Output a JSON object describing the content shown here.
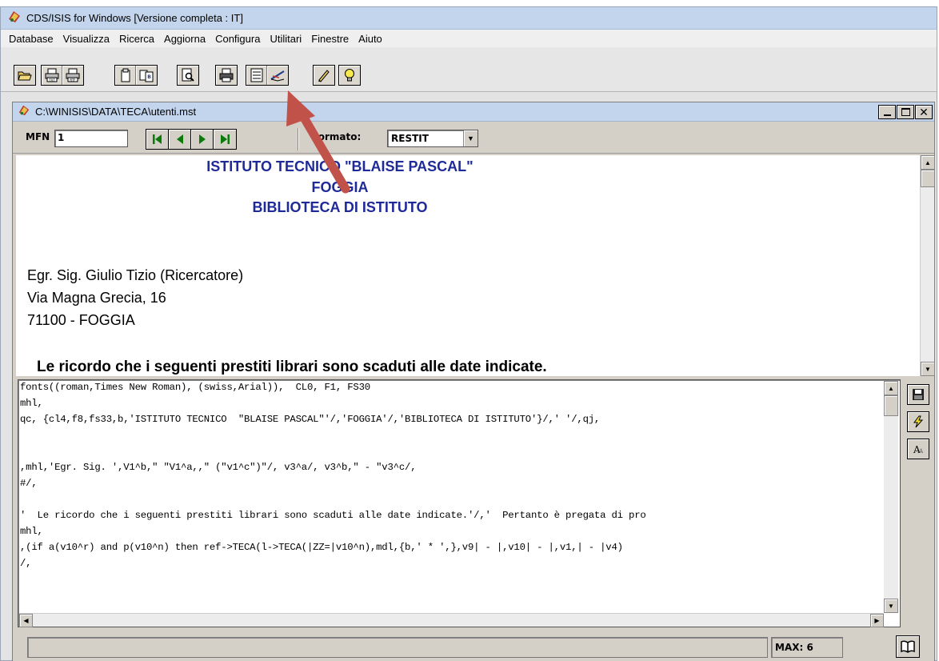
{
  "app": {
    "title": "CDS/ISIS for Windows [Versione completa : IT]",
    "menu": [
      "Database",
      "Visualizza",
      "Ricerca",
      "Aggiorna",
      "Configura",
      "Utilitari",
      "Finestre",
      "Aiuto"
    ],
    "toolbar_icons": [
      "open-folder",
      "print-txt",
      "print-rtf",
      "clipboard",
      "copy-record",
      "preview",
      "print",
      "display-format",
      "edit-format",
      "pencil",
      "lightbulb"
    ]
  },
  "child": {
    "title": "C:\\WINISIS\\DATA\\TECA\\utenti.mst",
    "mfn_label": "MFN",
    "mfn_value": "1",
    "format_label": "Formato:",
    "format_value": "RESTIT"
  },
  "display": {
    "header_line1": "ISTITUTO TECNICO  \"BLAISE PASCAL\"",
    "header_line2": "FOGGIA",
    "header_line3": "BIBLIOTECA DI ISTITUTO",
    "address_line1": "Egr. Sig. Giulio Tizio (Ricercatore)",
    "address_line2": "Via Magna Grecia, 16",
    "address_line3": "71100 - FOGGIA",
    "notice": "Le ricordo che i seguenti prestiti librari sono scaduti alle date indicate."
  },
  "editor": {
    "lines": [
      "fonts((roman,Times New Roman), (swiss,Arial)),  CL0, F1, FS30",
      "mhl,",
      "qc, {cl4,f8,fs33,b,'ISTITUTO TECNICO  \"BLAISE PASCAL\"'/,'FOGGIA'/,'BIBLIOTECA DI ISTITUTO'}/,' '/,qj,",
      "",
      "",
      ",mhl,'Egr. Sig. ',V1^b,\" \"V1^a,,\" (\"v1^c\")\"/, v3^a/, v3^b,\" - \"v3^c/,",
      "#/,",
      "",
      "'  Le ricordo che i seguenti prestiti librari sono scaduti alle date indicate.'/,'  Pertanto è pregata di pro",
      "mhl,",
      ",(if a(v10^r) and p(v10^n) then ref->TECA(l->TECA(|ZZ=|v10^n),mdl,{b,' * ',},v9| - |,v10| - |,v1,| - |v4)",
      "/,"
    ]
  },
  "status": {
    "max_label": "MAX: 6"
  },
  "colors": {
    "title_bar": "#c2d5ec",
    "header_text": "#1f2a99",
    "pointer_arrow": "#c0524a"
  }
}
